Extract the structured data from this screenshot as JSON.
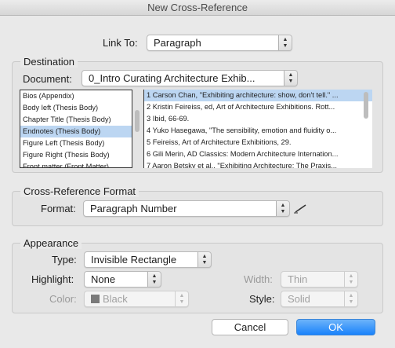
{
  "window": {
    "title": "New Cross-Reference"
  },
  "link_to": {
    "label": "Link To:",
    "value": "Paragraph"
  },
  "destination": {
    "title": "Destination",
    "document_label": "Document:",
    "document_value": "0_Intro Curating Architecture Exhib...",
    "styles": [
      "Bios (Appendix)",
      "Body left (Thesis Body)",
      "Chapter Title (Thesis Body)",
      "Endnotes (Thesis Body)",
      "Figure Left (Thesis Body)",
      "Figure Right (Thesis Body)",
      "Front matter (Front Matter)"
    ],
    "selected_style_index": 3,
    "paragraphs": [
      "1   Carson Chan, \"Exhibiting architecture: show, don't tell.\" ...",
      "2   Kristin Feireiss, ed, Art of Architecture Exhibitions. Rott...",
      "3   Ibid, 66-69.",
      "4   Yuko Hasegawa, \"The sensibility, emotion and fluidity o...",
      "5   Feireiss, Art of Architecture Exhibitions, 29.",
      "6   Gili Merin, AD Classics: Modern Architecture Internation...",
      "7   Aaron Betsky et al., \"Exhibiting Architecture: The Praxis..."
    ],
    "selected_paragraph_index": 0
  },
  "format_section": {
    "title": "Cross-Reference Format",
    "format_label": "Format:",
    "format_value": "Paragraph Number",
    "edit_icon": "pencil-icon"
  },
  "appearance": {
    "title": "Appearance",
    "type_label": "Type:",
    "type_value": "Invisible Rectangle",
    "highlight_label": "Highlight:",
    "highlight_value": "None",
    "color_label": "Color:",
    "color_value": "Black",
    "color_swatch": "#7a7a7a",
    "width_label": "Width:",
    "width_value": "Thin",
    "style_label": "Style:",
    "style_value": "Solid"
  },
  "buttons": {
    "cancel": "Cancel",
    "ok": "OK"
  }
}
